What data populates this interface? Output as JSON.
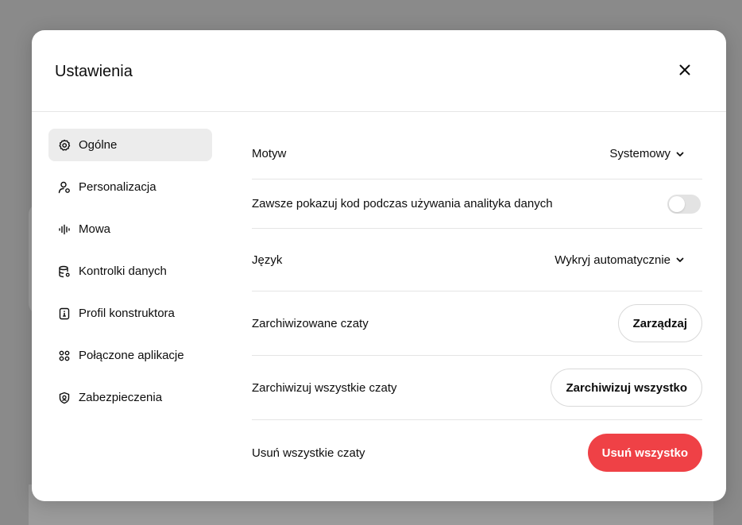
{
  "modal": {
    "title": "Ustawienia",
    "close_icon": "close-icon"
  },
  "sidebar": {
    "items": [
      {
        "label": "Ogólne",
        "icon": "gear-icon",
        "active": true
      },
      {
        "label": "Personalizacja",
        "icon": "person-settings-icon",
        "active": false
      },
      {
        "label": "Mowa",
        "icon": "waveform-icon",
        "active": false
      },
      {
        "label": "Kontrolki danych",
        "icon": "database-icon",
        "active": false
      },
      {
        "label": "Profil konstruktora",
        "icon": "id-card-icon",
        "active": false
      },
      {
        "label": "Połączone aplikacje",
        "icon": "apps-grid-icon",
        "active": false
      },
      {
        "label": "Zabezpieczenia",
        "icon": "shield-lock-icon",
        "active": false
      }
    ]
  },
  "settings": {
    "theme": {
      "label": "Motyw",
      "value": "Systemowy"
    },
    "always_show_code": {
      "label": "Zawsze pokazuj kod podczas używania analityka danych",
      "enabled": false
    },
    "language": {
      "label": "Język",
      "value": "Wykryj automatycznie"
    },
    "archived_chats": {
      "label": "Zarchiwizowane czaty",
      "button": "Zarządzaj"
    },
    "archive_all": {
      "label": "Zarchiwizuj wszystkie czaty",
      "button": "Zarchiwizuj wszystko"
    },
    "delete_all": {
      "label": "Usuń wszystkie czaty",
      "button": "Usuń wszystko"
    }
  },
  "colors": {
    "danger": "#ef4146",
    "active_nav_bg": "#ececec",
    "toggle_off": "#e3e3e3"
  }
}
